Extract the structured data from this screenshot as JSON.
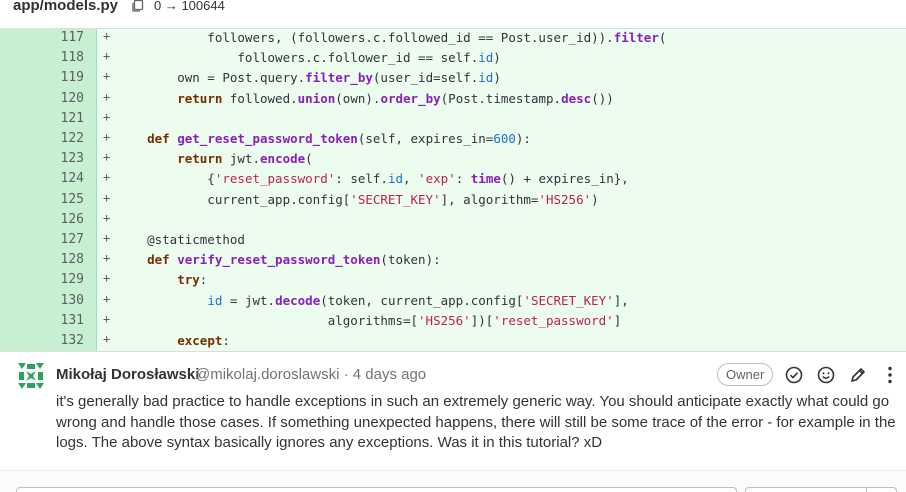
{
  "file": {
    "name": "app/models.py",
    "mode_change": "0 → 100644"
  },
  "diff": {
    "lines": [
      {
        "num": "117",
        "sign": "+",
        "code": "            followers, (followers.c.followed_id == Post.user_id)).filter("
      },
      {
        "num": "118",
        "sign": "+",
        "code": "                followers.c.follower_id == self.id)"
      },
      {
        "num": "119",
        "sign": "+",
        "code": "        own = Post.query.filter_by(user_id=self.id)"
      },
      {
        "num": "120",
        "sign": "+",
        "code": "        return followed.union(own).order_by(Post.timestamp.desc())"
      },
      {
        "num": "121",
        "sign": "+",
        "code": ""
      },
      {
        "num": "122",
        "sign": "+",
        "code": "    def get_reset_password_token(self, expires_in=600):"
      },
      {
        "num": "123",
        "sign": "+",
        "code": "        return jwt.encode("
      },
      {
        "num": "124",
        "sign": "+",
        "code": "            {'reset_password': self.id, 'exp': time() + expires_in},"
      },
      {
        "num": "125",
        "sign": "+",
        "code": "            current_app.config['SECRET_KEY'], algorithm='HS256')"
      },
      {
        "num": "126",
        "sign": "+",
        "code": ""
      },
      {
        "num": "127",
        "sign": "+",
        "code": "    @staticmethod"
      },
      {
        "num": "128",
        "sign": "+",
        "code": "    def verify_reset_password_token(token):"
      },
      {
        "num": "129",
        "sign": "+",
        "code": "        try:"
      },
      {
        "num": "130",
        "sign": "+",
        "code": "            id = jwt.decode(token, current_app.config['SECRET_KEY'],"
      },
      {
        "num": "131",
        "sign": "+",
        "code": "                            algorithms=['HS256'])['reset_password']"
      },
      {
        "num": "132",
        "sign": "+",
        "code": "        except:"
      }
    ]
  },
  "comment": {
    "author": "Mikołaj Dorosławski",
    "meta": "@mikolaj.doroslawski · 4 days ago",
    "badge": "Owner",
    "body": "it's generally bad practice to handle exceptions in such an extremely generic way. You should anticipate exactly what could go wrong and handle those cases. If something unexpected happens, there will still be some trace of the error - for example in the logs. The above syntax basically ignores any exceptions. Was it in this tutorial? xD",
    "actions": [
      "resolve-thread-icon",
      "add-reaction-icon",
      "edit-icon",
      "more-actions-icon"
    ]
  },
  "colors": {
    "added_bg": "#ecfdf0",
    "added_gutter": "#c7f0d2",
    "avatar": "#2da160"
  }
}
